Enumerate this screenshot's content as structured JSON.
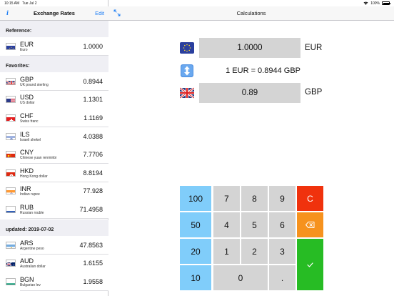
{
  "status": {
    "time": "10:15 AM",
    "date": "Tue Jul 2",
    "battery": "100%"
  },
  "sidebar": {
    "title": "Exchange Rates",
    "edit": "Edit",
    "info_icon": "info-icon",
    "reference_header": "Reference:",
    "reference": [
      {
        "code": "EUR",
        "name": "Euro",
        "rate": "1.0000",
        "flag": "eu"
      }
    ],
    "favorites_header": "Favorites:",
    "favorites": [
      {
        "code": "GBP",
        "name": "UK pound sterling",
        "rate": "0.8944",
        "flag": "gb"
      },
      {
        "code": "USD",
        "name": "US dollar",
        "rate": "1.1301",
        "flag": "us"
      },
      {
        "code": "CHF",
        "name": "Swiss franc",
        "rate": "1.1169",
        "flag": "ch"
      },
      {
        "code": "ILS",
        "name": "Israeli shekel",
        "rate": "4.0388",
        "flag": "il"
      },
      {
        "code": "CNY",
        "name": "Chinese yuan renminbi",
        "rate": "7.7706",
        "flag": "cn"
      },
      {
        "code": "HKD",
        "name": "Hong Kong dollar",
        "rate": "8.8194",
        "flag": "hk"
      },
      {
        "code": "INR",
        "name": "Indian rupee",
        "rate": "77.928",
        "flag": "in"
      },
      {
        "code": "RUB",
        "name": "Russian rouble",
        "rate": "71.4958",
        "flag": "ru"
      }
    ],
    "updated_header": "updated: 2019-07-02",
    "updated": [
      {
        "code": "ARS",
        "name": "Argentine peso",
        "rate": "47.8563",
        "flag": "ar"
      },
      {
        "code": "AUD",
        "name": "Australian dollar",
        "rate": "1.6155",
        "flag": "au"
      },
      {
        "code": "BGN",
        "name": "Bulgarian lev",
        "rate": "1.9558",
        "flag": "bg"
      }
    ]
  },
  "main": {
    "title": "Calculations",
    "from_value": "1.0000",
    "from_code": "EUR",
    "rate_line": "1 EUR = 0.8944 GBP",
    "to_value": "0.89",
    "to_code": "GBP"
  },
  "keypad": {
    "k100": "100",
    "k50": "50",
    "k20": "20",
    "k10": "10",
    "k7": "7",
    "k8": "8",
    "k9": "9",
    "k4": "4",
    "k5": "5",
    "k6": "6",
    "k1": "1",
    "k2": "2",
    "k3": "3",
    "k0": "0",
    "kdot": ".",
    "clear": "C"
  },
  "colors": {
    "accent": "#1a7cf5",
    "blue_key": "#80cdfa",
    "red_key": "#f0320d",
    "orange_key": "#f6921e",
    "green_key": "#27bc24"
  }
}
